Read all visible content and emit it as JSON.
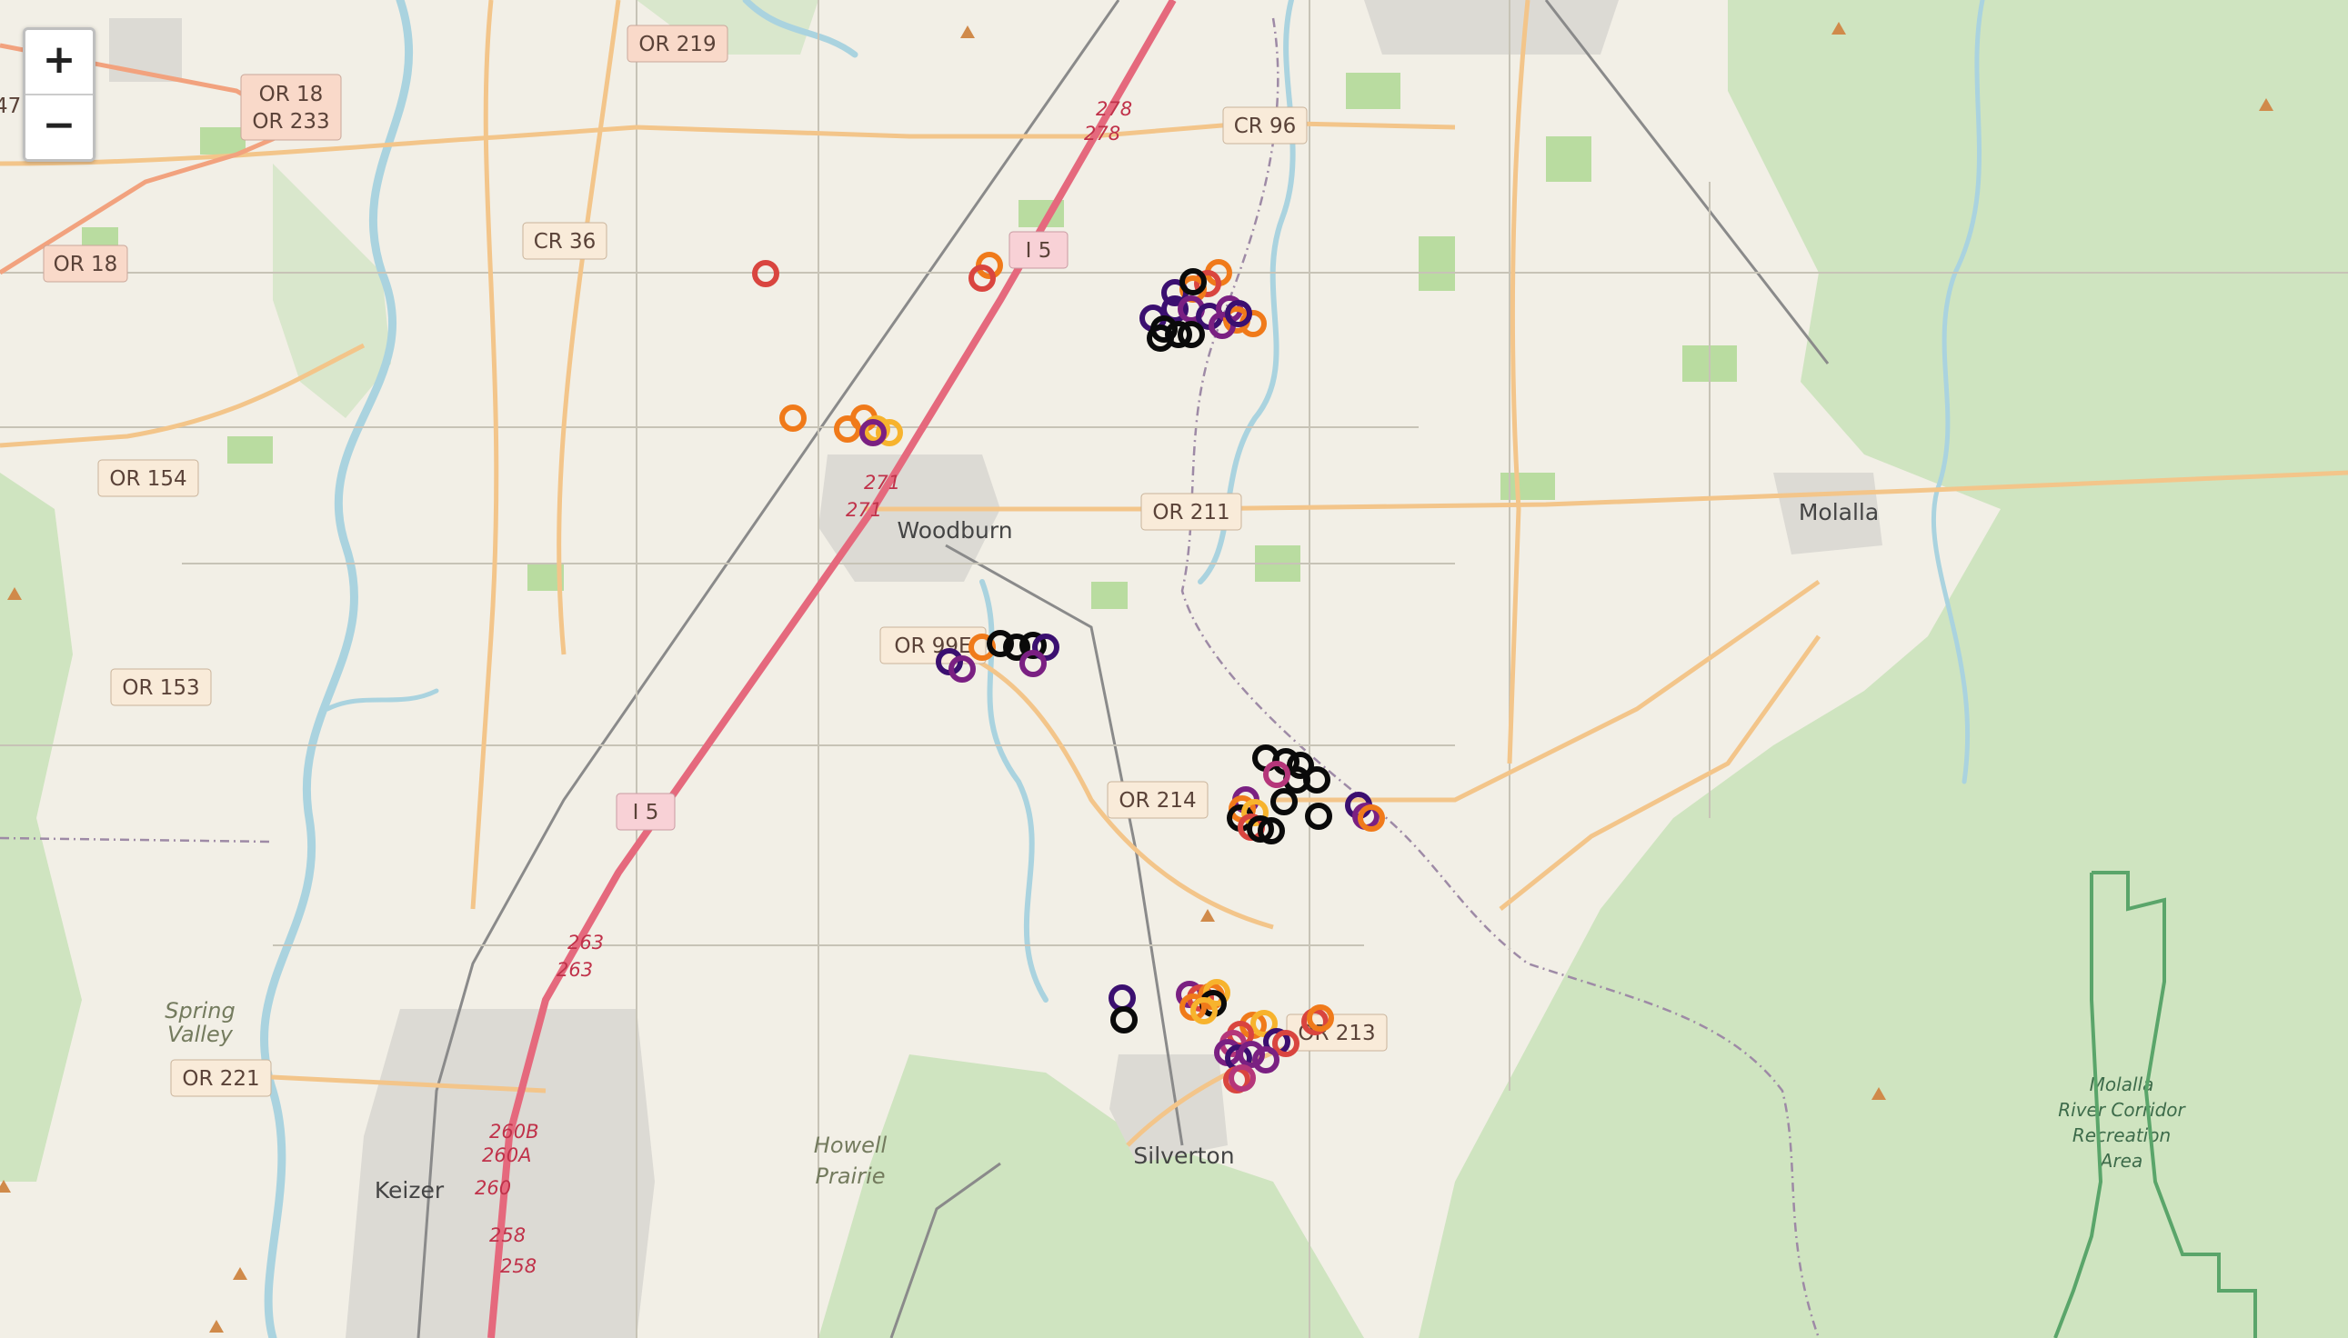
{
  "zoom": {
    "in_label": "+",
    "out_label": "−"
  },
  "shields": {
    "or219": "OR 219",
    "or18_233_a": "OR 18",
    "or18_233_b": "OR 233",
    "or18": "OR 18",
    "cr36": "CR 36",
    "i5_north": "I 5",
    "cr96": "CR 96",
    "or154": "OR 154",
    "or211": "OR 211",
    "or99e": "OR 99E",
    "or153": "OR 153",
    "i5_south": "I 5",
    "or214": "OR 214",
    "or213": "OR 213",
    "or221": "OR 221"
  },
  "places": {
    "woodburn": "Woodburn",
    "molalla": "Molalla",
    "silverton": "Silverton",
    "keizer": "Keizer",
    "howell_prairie_1": "Howell",
    "howell_prairie_2": "Prairie",
    "spring_valley_1": "Spring",
    "spring_valley_2": "Valley",
    "molalla_rec_1": "Molalla",
    "molalla_rec_2": "River Corridor",
    "molalla_rec_3": "Recreation",
    "molalla_rec_4": "Area"
  },
  "exits": {
    "e278a": "278",
    "e278b": "278",
    "e271a": "271",
    "e271b": "271",
    "e263a": "263",
    "e263b": "263",
    "e260b": "260B",
    "e260a": "260A",
    "e260": "260",
    "e258a": "258",
    "e258b": "258"
  },
  "edge_label": "47",
  "marker_colors": {
    "black": "#0a0a0a",
    "dark_purple": "#3b0f70",
    "purple": "#7a2082",
    "magenta": "#b5367a",
    "red": "#d9453f",
    "orange": "#f07a1a",
    "yellow": "#f7b32d"
  }
}
